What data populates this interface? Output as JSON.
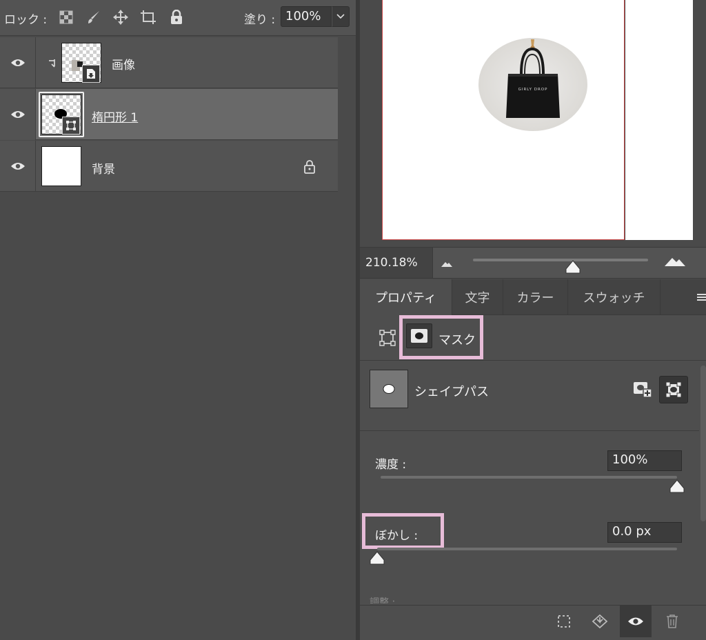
{
  "layers_panel": {
    "lock_label": "ロック :",
    "fill_label": "塗り :",
    "fill_value": "100%",
    "lock_icons": [
      "transparency-lock-icon",
      "brush-lock-icon",
      "move-lock-icon",
      "artboard-lock-icon",
      "padlock-icon"
    ],
    "layers": [
      {
        "name": "画像",
        "selected": false,
        "clipped": true
      },
      {
        "name": "楕円形 1",
        "selected": true,
        "clipped": false
      },
      {
        "name": "背景",
        "selected": false,
        "locked": true
      }
    ]
  },
  "canvas": {
    "bag_text": "GIRLY DROP"
  },
  "zoom": {
    "value": "210.18%",
    "slider_fraction": 0.57
  },
  "properties": {
    "tabs": [
      "プロパティ",
      "文字",
      "カラー",
      "スウォッチ"
    ],
    "active_tab": "プロパティ",
    "mode_label": "マスク",
    "shape_label": "シェイプパス",
    "density_label": "濃度 :",
    "density_value": "100%",
    "density_fraction": 1.0,
    "feather_label": "ぼかし :",
    "feather_value": "0.0 px",
    "feather_fraction": 0.0,
    "adjust_label": "調整 :"
  },
  "colors": {
    "highlight": "#e7bcd8",
    "doc_border": "#c84545"
  }
}
